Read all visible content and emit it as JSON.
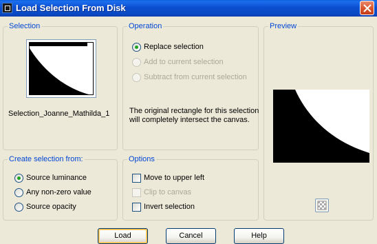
{
  "window": {
    "title": "Load Selection From Disk"
  },
  "selection_group": {
    "legend": "Selection",
    "selection_name": "Selection_Joanne_Mathilda_1"
  },
  "operation_group": {
    "legend": "Operation",
    "options": [
      {
        "label": "Replace selection",
        "checked": true,
        "enabled": true
      },
      {
        "label": "Add to current selection",
        "checked": false,
        "enabled": false
      },
      {
        "label": "Subtract from current selection",
        "checked": false,
        "enabled": false
      }
    ],
    "info_text": "The original rectangle for this selection will completely intersect the canvas."
  },
  "preview_group": {
    "legend": "Preview",
    "toggle_icon": "checkerboard-icon"
  },
  "create_group": {
    "legend": "Create selection from:",
    "options": [
      {
        "label": "Source luminance",
        "checked": true
      },
      {
        "label": "Any non-zero value",
        "checked": false
      },
      {
        "label": "Source opacity",
        "checked": false
      }
    ]
  },
  "options_group": {
    "legend": "Options",
    "checks": [
      {
        "label": "Move to upper left",
        "checked": false,
        "enabled": true
      },
      {
        "label": "Clip to canvas",
        "checked": false,
        "enabled": false
      },
      {
        "label": "Invert selection",
        "checked": false,
        "enabled": true
      }
    ]
  },
  "buttons": {
    "load": "Load",
    "cancel": "Cancel",
    "help": "Help"
  },
  "colors": {
    "legend": "#0046d5",
    "titlebar": "#0a49c4",
    "dialog_bg": "#ece9d8",
    "radio_dot": "#21a121"
  }
}
